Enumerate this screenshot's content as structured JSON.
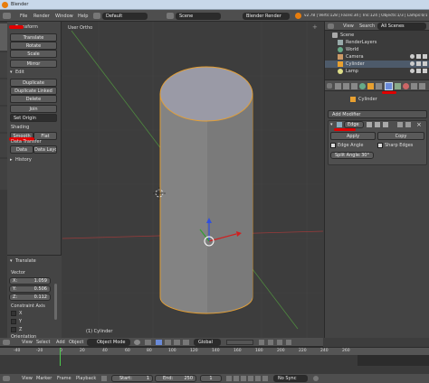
{
  "window": {
    "title": "Blender"
  },
  "topbar": {
    "menus": [
      "File",
      "Render",
      "Window",
      "Help"
    ],
    "layout": "Default",
    "scene": "Scene",
    "engine": "Blender Render",
    "stats": "v2.78 | Verts:128 | Faces:34 | Tris:124 | Objects:1/3 | Lamps:0/1 | Mem:9.28M"
  },
  "toolshelf": {
    "side_tabs": [
      "Tools",
      "Create",
      "Relations",
      "Animation",
      "Physics",
      "Grease Pencil"
    ],
    "transform_header": "Transform",
    "transform_buttons": [
      "Translate",
      "Rotate",
      "Scale",
      "Mirror"
    ],
    "edit_header": "Edit",
    "edit_buttons": [
      "Duplicate",
      "Duplicate Linked",
      "Delete",
      "Join"
    ],
    "set_origin": "Set Origin",
    "shading_label": "Shading",
    "smooth": "Smooth",
    "flat": "Flat",
    "data_transfer_label": "Data Transfer",
    "data": "Data",
    "data_layout": "Data Layo",
    "history_header": "History"
  },
  "operator": {
    "header": "Translate",
    "vector_label": "Vector",
    "x": "X:",
    "x_value": "1.059",
    "y": "Y:",
    "y_value": "0.506",
    "z": "Z:",
    "z_value": "0.112",
    "constraint_label": "Constraint Axis",
    "axes": [
      "X",
      "Y",
      "Z"
    ],
    "orientation_label": "Orientation"
  },
  "viewport": {
    "label": "User Ortho",
    "object_label": "(1) Cylinder"
  },
  "view_header": {
    "menus": [
      "View",
      "Select",
      "Add",
      "Object"
    ],
    "mode": "Object Mode",
    "pivot": "Global"
  },
  "timeline": {
    "ruler": [
      "-40",
      "-20",
      "0",
      "20",
      "40",
      "60",
      "80",
      "100",
      "120",
      "140",
      "160",
      "180",
      "200",
      "220",
      "240",
      "260"
    ],
    "menus": [
      "View",
      "Marker",
      "Frame",
      "Playback"
    ],
    "start": "Start:",
    "start_value": "1",
    "end": "End:",
    "end_value": "250",
    "current": "1",
    "sync": "No Sync"
  },
  "outliner": {
    "menus": [
      "View",
      "Search"
    ],
    "filter": "All Scenes",
    "items": [
      "Scene",
      "RenderLayers",
      "World",
      "Camera",
      "Cylinder",
      "Lamp"
    ]
  },
  "properties": {
    "object_name": "Cylinder",
    "add_modifier": "Add Modifier",
    "modifier_name": "Edge",
    "apply": "Apply",
    "copy": "Copy",
    "edge_angle": "Edge Angle",
    "sharp_edges": "Sharp Edges",
    "split_angle": "Split Angle:",
    "split_angle_value": "30°"
  },
  "colors": {
    "accent_orange": "#e8a030",
    "grid_red": "#9a3b3b",
    "grid_green": "#4f8a3f",
    "annotation_red": "#e00000"
  }
}
